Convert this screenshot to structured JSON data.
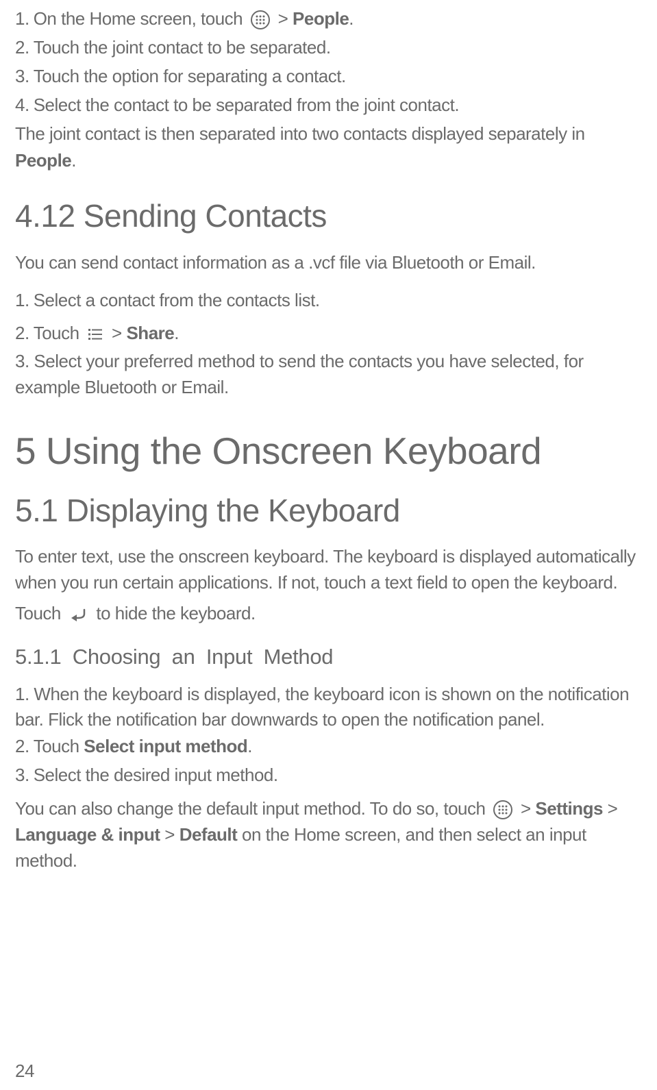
{
  "sep": {
    "step1_a": "On the Home screen, touch",
    "step1_b": " > ",
    "step1_c": "People",
    "step1_d": ".",
    "step2": "Touch the joint contact to be separated.",
    "step3": "Touch the option for separating a contact.",
    "step4": "Select the contact to be separated from the joint contact.",
    "result_a": "The joint contact is then separated into two contacts displayed separately in ",
    "result_b": "People",
    "result_c": "."
  },
  "h412": "4.12  Sending Contacts",
  "send": {
    "intro": "You can send contact information as a .vcf file via Bluetooth or Email.",
    "step1": "Select a contact from the contacts list.",
    "step2_a": "Touch",
    "step2_b": " > ",
    "step2_c": "Share",
    "step2_d": ".",
    "step3": "Select your preferred method to send the contacts you have selected, for example Bluetooth or Email."
  },
  "h5": "5  Using the Onscreen Keyboard",
  "h51": "5.1  Displaying the Keyboard",
  "kb": {
    "intro": "To enter text, use the onscreen keyboard. The keyboard is displayed automatically when you run certain applications. If not, touch a text field to open the keyboard.",
    "hide_a": "Touch",
    "hide_b": " to hide the keyboard."
  },
  "h511": "5.1.1  Choosing an Input Method",
  "input": {
    "step1": "When the keyboard is displayed, the keyboard icon is shown on the notification bar. Flick the notification bar downwards to open the notification panel.",
    "step2_a": "Touch ",
    "step2_b": "Select input method",
    "step2_c": ".",
    "step3": "Select the desired input method.",
    "change_a": "You can also change the default input method. To do so, touch",
    "change_b": " > ",
    "change_c": "Settings",
    "change_d": " > ",
    "change_e": "Language & input",
    "change_f": " > ",
    "change_g": "Default",
    "change_h": " on the Home screen, and then select an input method."
  },
  "pagenum": "24"
}
